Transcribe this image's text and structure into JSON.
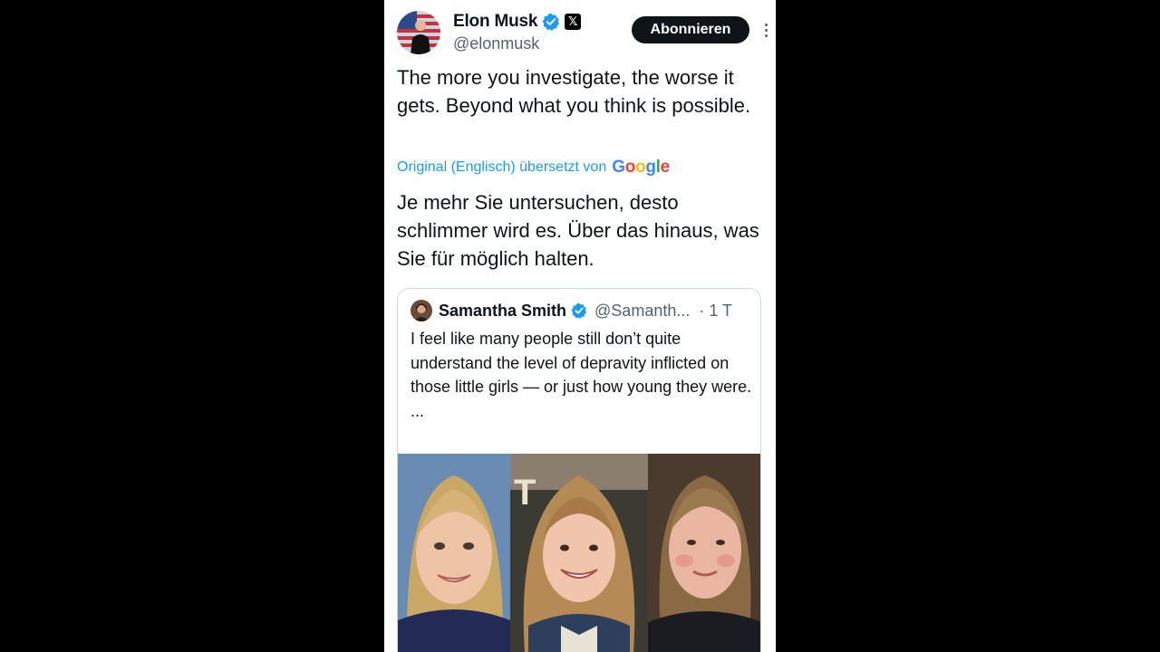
{
  "author": {
    "display_name": "Elon Musk",
    "handle": "@elonmusk",
    "avatar_icon": "profile-avatar",
    "verified_icon": "verified-badge-icon",
    "org_badge": "𝕏"
  },
  "actions": {
    "subscribe_label": "Abonnieren",
    "more_icon": "more-dots-icon"
  },
  "tweet": {
    "text": "The more you investigate, the worse it gets. Beyond what you think is possible.",
    "translation_label": "Original (Englisch) übersetzt von",
    "translation_provider": "Google",
    "translation": "Je mehr Sie untersuchen, desto schlimmer wird es. Über das hinaus, was Sie für möglich halten."
  },
  "quote": {
    "display_name": "Samantha Smith",
    "handle": "@Samanth...",
    "time": "· 1 T",
    "text": "I feel like many people still don’t quite understand the level of depravity inflicted on those little girls — or just how young they were.",
    "ellipsis": "...",
    "photos": [
      "photo-1",
      "photo-2",
      "photo-3"
    ]
  },
  "colors": {
    "accent": "#1d9bf0",
    "text": "#0f1419",
    "secondary": "#536471",
    "button_bg": "#0f1419",
    "border": "#cfd9de"
  }
}
